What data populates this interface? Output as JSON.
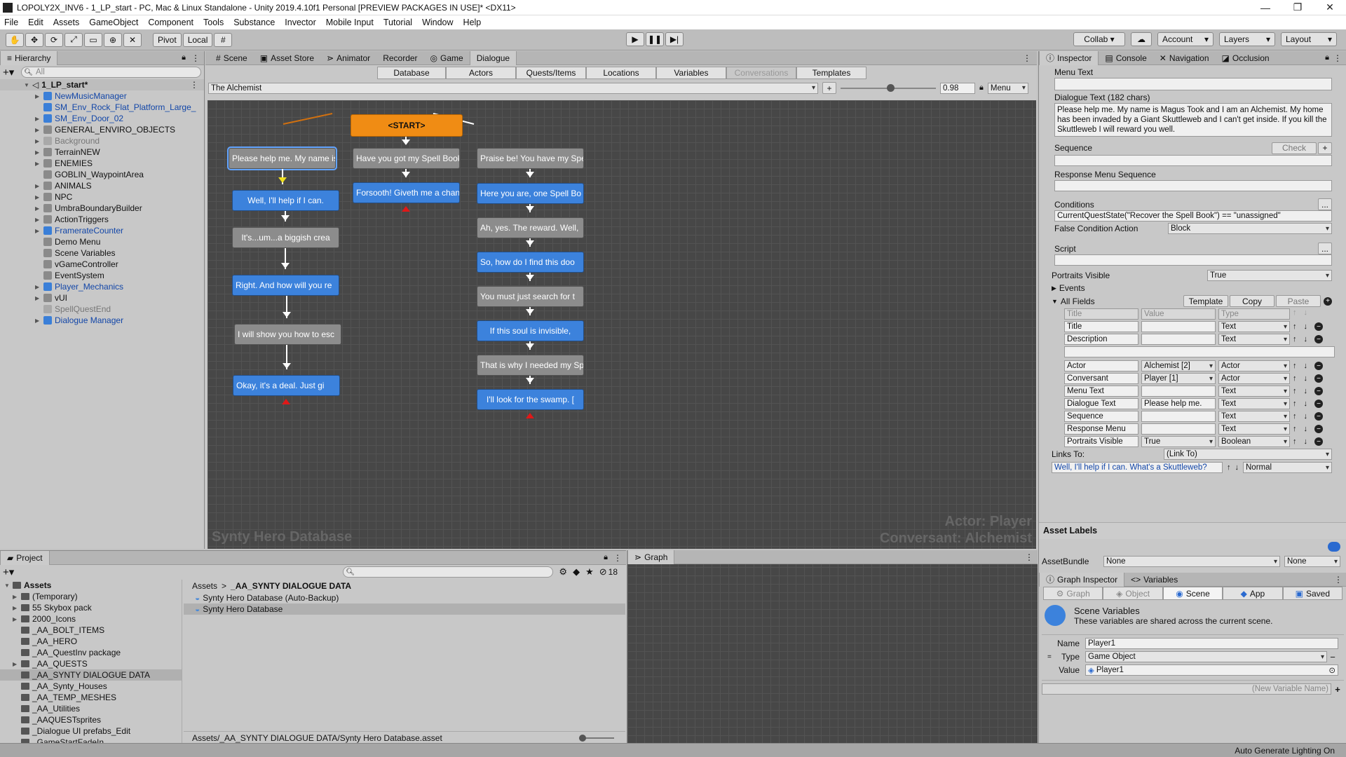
{
  "window": {
    "title": "LOPOLY2X_INV6 - 1_LP_start - PC, Mac & Linux Standalone - Unity 2019.4.10f1 Personal [PREVIEW PACKAGES IN USE]* <DX11>",
    "min": "—",
    "max": "❐",
    "close": "✕"
  },
  "menu": [
    "File",
    "Edit",
    "Assets",
    "GameObject",
    "Component",
    "Tools",
    "Substance",
    "Invector",
    "Mobile Input",
    "Tutorial",
    "Window",
    "Help"
  ],
  "toolbar": {
    "pivot": "Pivot",
    "local": "Local",
    "collab": "Collab ▾",
    "account": "Account",
    "layers": "Layers",
    "layout": "Layout"
  },
  "hierarchy": {
    "tab": "Hierarchy",
    "search_placeholder": "All",
    "scene": "1_LP_start*",
    "items": [
      {
        "label": "NewMusicManager",
        "style": "blue",
        "indent": 1,
        "arrow": "▶"
      },
      {
        "label": "SM_Env_Rock_Flat_Platform_Large_",
        "style": "blue",
        "indent": 1,
        "arrow": ""
      },
      {
        "label": "SM_Env_Door_02",
        "style": "blue",
        "indent": 1,
        "arrow": "▶"
      },
      {
        "label": "GENERAL_ENVIRO_OBJECTS",
        "style": "gray",
        "indent": 1,
        "arrow": "▶"
      },
      {
        "label": "Background",
        "style": "dim",
        "indent": 1,
        "arrow": "▶"
      },
      {
        "label": "TerrainNEW",
        "style": "gray",
        "indent": 1,
        "arrow": "▶"
      },
      {
        "label": "ENEMIES",
        "style": "gray",
        "indent": 1,
        "arrow": "▶"
      },
      {
        "label": "GOBLIN_WaypointArea",
        "style": "gray",
        "indent": 1,
        "arrow": ""
      },
      {
        "label": "ANIMALS",
        "style": "gray",
        "indent": 1,
        "arrow": "▶"
      },
      {
        "label": "NPC",
        "style": "gray",
        "indent": 1,
        "arrow": "▶"
      },
      {
        "label": "UmbraBoundaryBuilder",
        "style": "gray",
        "indent": 1,
        "arrow": "▶"
      },
      {
        "label": "ActionTriggers",
        "style": "gray",
        "indent": 1,
        "arrow": "▶"
      },
      {
        "label": "FramerateCounter",
        "style": "blue",
        "indent": 1,
        "arrow": "▶"
      },
      {
        "label": "Demo Menu",
        "style": "gray",
        "indent": 1,
        "arrow": ""
      },
      {
        "label": "Scene Variables",
        "style": "gray",
        "indent": 1,
        "arrow": ""
      },
      {
        "label": "vGameController",
        "style": "gray",
        "indent": 1,
        "arrow": ""
      },
      {
        "label": "EventSystem",
        "style": "gray",
        "indent": 1,
        "arrow": ""
      },
      {
        "label": "Player_Mechanics",
        "style": "blue",
        "indent": 1,
        "arrow": "▶"
      },
      {
        "label": "vUI",
        "style": "gray",
        "indent": 1,
        "arrow": "▶"
      },
      {
        "label": "SpellQuestEnd",
        "style": "dim",
        "indent": 1,
        "arrow": ""
      },
      {
        "label": "Dialogue Manager",
        "style": "blue",
        "indent": 1,
        "arrow": "▶"
      }
    ]
  },
  "center_tabs": [
    "Scene",
    "Asset Store",
    "Animator",
    "Recorder",
    "Game",
    "Dialogue"
  ],
  "dialogue": {
    "subtabs": [
      "Database",
      "Actors",
      "Quests/Items",
      "Locations",
      "Variables",
      "Conversations",
      "Templates"
    ],
    "conversation": "The Alchemist",
    "plus": "+",
    "zoom": "0.98",
    "menu": "Menu",
    "watermark_db": "Synty Hero Database",
    "watermark_actor": "Actor: Player",
    "watermark_conversant": "Conversant: Alchemist",
    "nodes": {
      "start": "<START>",
      "n1": "Please help me. My name is",
      "n2": "Well, I'll help if I can.",
      "n3": "It's...um...a biggish crea",
      "n4": "Right. And how will you re",
      "n5": "I will show you how to esc",
      "n6": "Okay, it's a deal. Just gi",
      "m1": "Have you got my Spell Book",
      "m2": "Forsooth! Giveth me a chan",
      "r1": "Praise be! You have my Spe",
      "r2": "Here you are, one Spell Bo",
      "r3": "Ah, yes. The reward. Well,",
      "r4": "So, how do I find this doo",
      "r5": "You must just search for t",
      "r6": "If this soul is invisible,",
      "r7": "That is why I needed my Sp",
      "r8": "I'll look for the swamp. ["
    }
  },
  "inspector": {
    "tabs": [
      "Inspector",
      "Console",
      "Navigation",
      "Occlusion"
    ],
    "menu_text_label": "Menu Text",
    "dialogue_text_label": "Dialogue Text (182 chars)",
    "dialogue_text": "Please help me. My name is Magus Took and I am an Alchemist. My home has been invaded by a Giant Skuttleweb and I can't get inside. If you kill the Skuttleweb I will reward you well.",
    "sequence_label": "Sequence",
    "check": "Check",
    "plus": "+",
    "response_menu_sequence_label": "Response Menu Sequence",
    "conditions_label": "Conditions",
    "ellipsis": "...",
    "conditions_value": "CurrentQuestState(\"Recover the Spell Book\") == \"unassigned\"",
    "false_condition_label": "False Condition Action",
    "false_condition_value": "Block",
    "script_label": "Script",
    "portraits_visible_label": "Portraits Visible",
    "portraits_visible_value": "True",
    "events_label": "Events",
    "all_fields_label": "All Fields",
    "template_btn": "Template",
    "copy_btn": "Copy",
    "paste_btn": "Paste",
    "headers": [
      "Title",
      "Value",
      "Type"
    ],
    "rows1": [
      {
        "title": "Title",
        "value": "",
        "type": "Text"
      },
      {
        "title": "Description",
        "value": "",
        "type": "Text"
      }
    ],
    "rows2": [
      {
        "title": "Actor",
        "value": "Alchemist [2]",
        "type": "Actor"
      },
      {
        "title": "Conversant",
        "value": "Player [1]",
        "type": "Actor"
      },
      {
        "title": "Menu Text",
        "value": "",
        "type": "Text"
      },
      {
        "title": "Dialogue Text",
        "value": "Please help me.",
        "type": "Text"
      },
      {
        "title": "Sequence",
        "value": "",
        "type": "Text"
      },
      {
        "title": "Response Menu",
        "value": "",
        "type": "Text"
      },
      {
        "title": "Portraits Visible",
        "value": "True",
        "type": "Boolean"
      }
    ],
    "links_to_label": "Links To:",
    "links_to_value": "(Link To)",
    "link_item": "Well, I'll help if I can. What's a Skuttleweb?",
    "link_priority": "Normal",
    "asset_labels": "Asset Labels",
    "asset_bundle_label": "AssetBundle",
    "asset_bundle_value": "None",
    "asset_bundle_variant": "None"
  },
  "graph_inspector": {
    "tabs": [
      "Graph Inspector",
      "Variables"
    ],
    "scope_tabs": [
      "Graph",
      "Object",
      "Scene",
      "App",
      "Saved"
    ],
    "title": "Scene Variables",
    "desc": "These variables are shared across the current scene.",
    "name_label": "Name",
    "name_value": "Player1",
    "type_label": "Type",
    "type_value": "Game Object",
    "value_label": "Value",
    "value_value": "Player1",
    "new_var_placeholder": "(New Variable Name)",
    "plus": "+",
    "minus": "−"
  },
  "project": {
    "tab": "Project",
    "count": "18",
    "tree_root": "Assets",
    "tree": [
      "(Temporary)",
      "55 Skybox pack",
      "2000_Icons",
      "_AA_BOLT_ITEMS",
      "_AA_HERO",
      "_AA_QuestInv package",
      "_AA_QUESTS",
      "_AA_SYNTY DIALOGUE DATA",
      "_AA_Synty_Houses",
      "_AA_TEMP_MESHES",
      "_AA_Utilities",
      "_AAQUESTsprites",
      "_Dialogue UI prefabs_Edit",
      "_GameStartFadeIn"
    ],
    "breadcrumb_root": "Assets",
    "breadcrumb_sep": ">",
    "breadcrumb_folder": "_AA_SYNTY DIALOGUE DATA",
    "files": [
      "Synty Hero Database (Auto-Backup)",
      "Synty Hero Database"
    ],
    "path": "Assets/_AA_SYNTY DIALOGUE DATA/Synty Hero Database.asset"
  },
  "graph_tab": "Graph",
  "status": "Auto Generate Lighting On"
}
